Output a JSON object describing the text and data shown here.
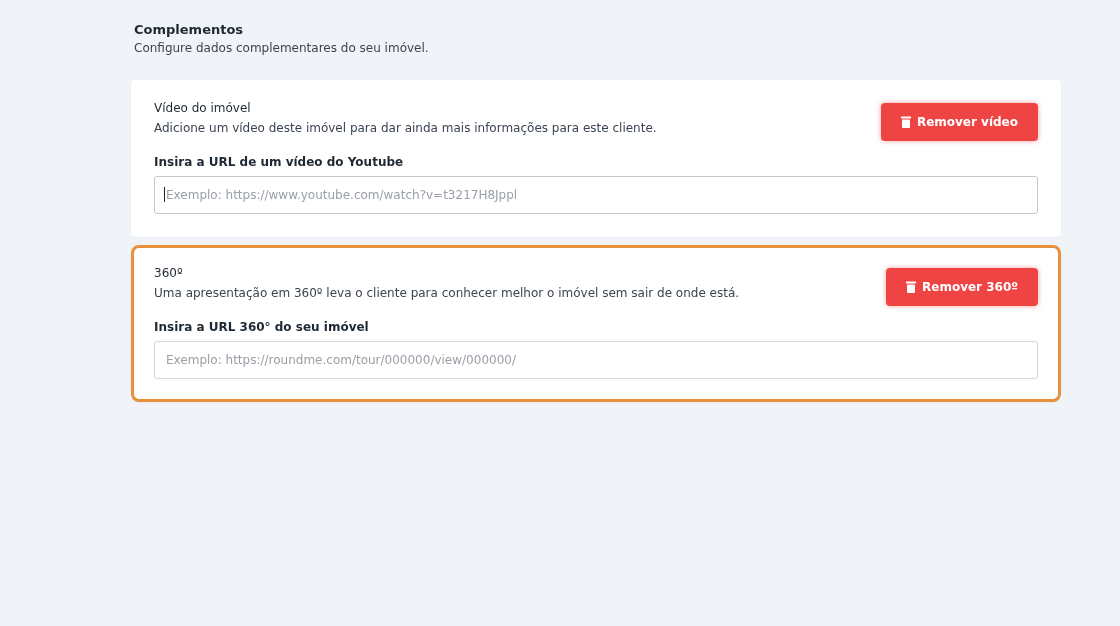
{
  "section": {
    "title": "Complementos",
    "subtitle": "Configure dados complementares do seu imóvel."
  },
  "cards": [
    {
      "title": "Vídeo do imóvel",
      "description": "Adicione um vídeo deste imóvel para dar ainda mais informações para este cliente.",
      "button": "Remover vídeo",
      "field_label": "Insira a URL de um vídeo do Youtube",
      "placeholder": "Exemplo: https://www.youtube.com/watch?v=t3217H8Jppl",
      "focused": true,
      "highlighted": false
    },
    {
      "title": "360º",
      "description": "Uma apresentação em 360º leva o cliente para conhecer melhor o imóvel sem sair de onde está.",
      "button": "Remover 360º",
      "field_label": "Insira a URL 360° do seu imóvel",
      "placeholder": "Exemplo: https://roundme.com/tour/000000/view/000000/",
      "focused": false,
      "highlighted": true
    }
  ]
}
